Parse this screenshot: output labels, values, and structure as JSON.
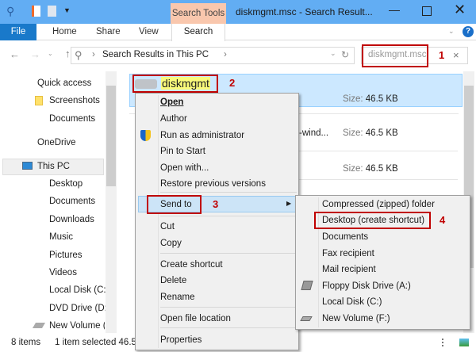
{
  "window": {
    "title": "diskmgmt.msc - Search Result...",
    "context_tab": "Search Tools"
  },
  "ribbon": {
    "tabs": [
      "File",
      "Home",
      "Share",
      "View",
      "Search"
    ]
  },
  "address": {
    "path": "Search Results in This PC",
    "search_value": "diskmgmt.msc"
  },
  "nav": [
    "Quick access",
    "Screenshots",
    "Documents",
    "OneDrive",
    "This PC",
    "Desktop",
    "Documents",
    "Downloads",
    "Music",
    "Pictures",
    "Videos",
    "Local Disk (C:)",
    "DVD Drive (D:)",
    "New Volume ("
  ],
  "files": [
    {
      "name": "diskmgmt",
      "size_label": "Size:",
      "size": "46.5 KB"
    },
    {
      "name": "-wind...",
      "size_label": "Size:",
      "size": "46.5 KB"
    },
    {
      "name": "",
      "size_label": "Size:",
      "size": "46.5 KB"
    }
  ],
  "context_menu": [
    "Open",
    "Author",
    "Run as administrator",
    "Pin to Start",
    "Open with...",
    "Restore previous versions",
    "Send to",
    "Cut",
    "Copy",
    "Create shortcut",
    "Delete",
    "Rename",
    "Open file location",
    "Properties"
  ],
  "send_to_menu": [
    "Compressed (zipped) folder",
    "Desktop (create shortcut)",
    "Documents",
    "Fax recipient",
    "Mail recipient",
    "Floppy Disk Drive (A:)",
    "Local Disk (C:)",
    "New Volume (F:)"
  ],
  "annotations": [
    "1",
    "2",
    "3",
    "4"
  ],
  "status": {
    "items": "8 items",
    "selected": "1 item selected  46.5"
  }
}
